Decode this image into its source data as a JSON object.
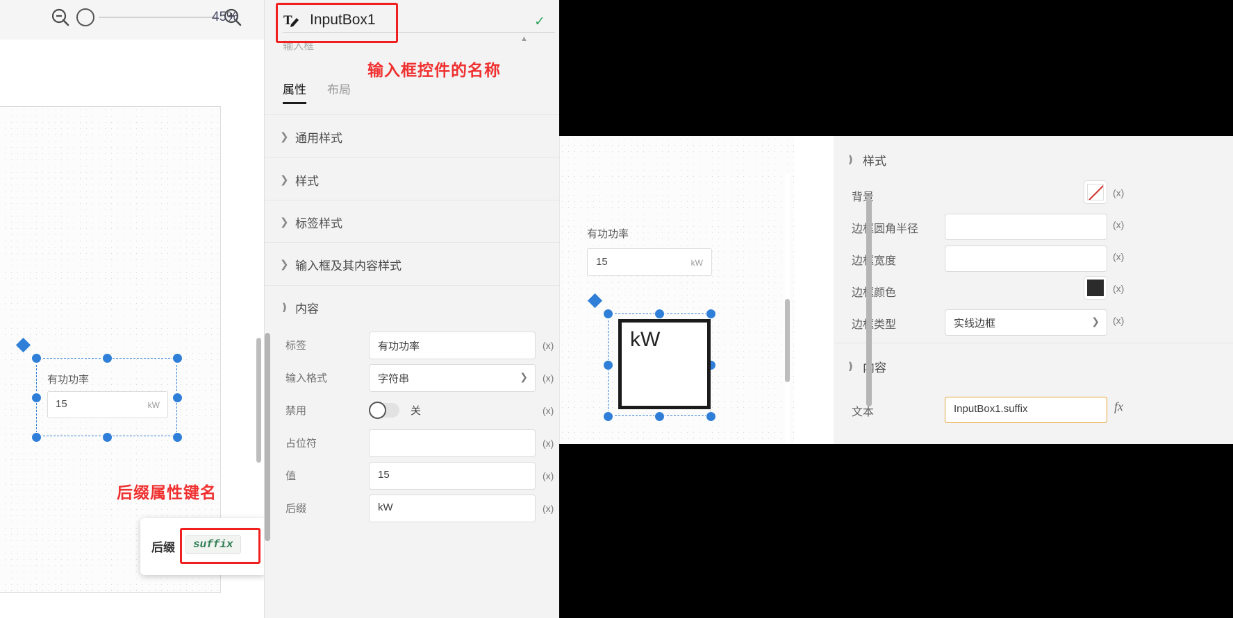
{
  "left_screenshot": {
    "toolbar": {
      "zoom_out_icon": "zoom-out-icon",
      "slider_handle_icon": "slider-handle-icon",
      "zoom_in_icon": "zoom-in-icon",
      "zoom_level": "45%"
    },
    "canvas": {
      "widget": {
        "label": "有功功率",
        "value": "15",
        "suffix": "kW"
      }
    },
    "annotations": {
      "suffix_key_note": "后缀属性键名",
      "widget_name_note": "输入框控件的名称"
    },
    "tooltip_card": {
      "label": "后缀",
      "code": "suffix"
    },
    "panel": {
      "component_icon": "text-edit-icon",
      "component_name": "InputBox1",
      "component_type": "输入框",
      "confirm_icon": "check-icon",
      "scroll_up_icon": "chevron-up-icon",
      "tabs": [
        {
          "label": "属性",
          "active": true
        },
        {
          "label": "布局",
          "active": false
        }
      ],
      "sections": [
        {
          "label": "通用样式",
          "expanded": false
        },
        {
          "label": "样式",
          "expanded": false
        },
        {
          "label": "标签样式",
          "expanded": false
        },
        {
          "label": "输入框及其内容样式",
          "expanded": false
        },
        {
          "label": "内容",
          "expanded": true
        }
      ],
      "content_fields": [
        {
          "label": "标签",
          "value": "有功功率",
          "type": "text",
          "fx": "(x)"
        },
        {
          "label": "输入格式",
          "value": "字符串",
          "type": "select",
          "fx": "(x)"
        },
        {
          "label": "禁用",
          "value": "关",
          "type": "toggle",
          "fx": "(x)"
        },
        {
          "label": "占位符",
          "value": "",
          "type": "text",
          "fx": "(x)"
        },
        {
          "label": "值",
          "value": "15",
          "type": "text",
          "fx": "(x)"
        },
        {
          "label": "后缀",
          "value": "kW",
          "type": "text",
          "fx": "(x)"
        }
      ]
    }
  },
  "right_screenshot": {
    "canvas": {
      "widget": {
        "label": "有功功率",
        "value": "15",
        "suffix": "kW"
      },
      "selected_text": "kW"
    },
    "panel": {
      "sections": [
        {
          "label": "样式",
          "expanded": true
        },
        {
          "label": "内容",
          "expanded": true
        }
      ],
      "style_fields": [
        {
          "label": "背景",
          "value": "",
          "type": "color",
          "swatch": "none",
          "fx": "(x)"
        },
        {
          "label": "边框圆角半径",
          "value": "",
          "type": "text",
          "fx": "(x)"
        },
        {
          "label": "边框宽度",
          "value": "",
          "type": "text",
          "fx": "(x)"
        },
        {
          "label": "边框颜色",
          "value": "",
          "type": "color",
          "swatch": "#2b2b2b",
          "fx": "(x)"
        },
        {
          "label": "边框类型",
          "value": "实线边框",
          "type": "select",
          "fx": "(x)"
        }
      ],
      "content_fields": [
        {
          "label": "文本",
          "value": "InputBox1.suffix",
          "type": "text",
          "fx": "fx",
          "focused": true
        }
      ]
    }
  },
  "colors": {
    "accent_blue": "#2f7fd8",
    "annotation_red": "#f03030",
    "focus_orange": "#e8a33d",
    "code_green": "#2e7d52",
    "border_dark": "#2b2b2b"
  }
}
